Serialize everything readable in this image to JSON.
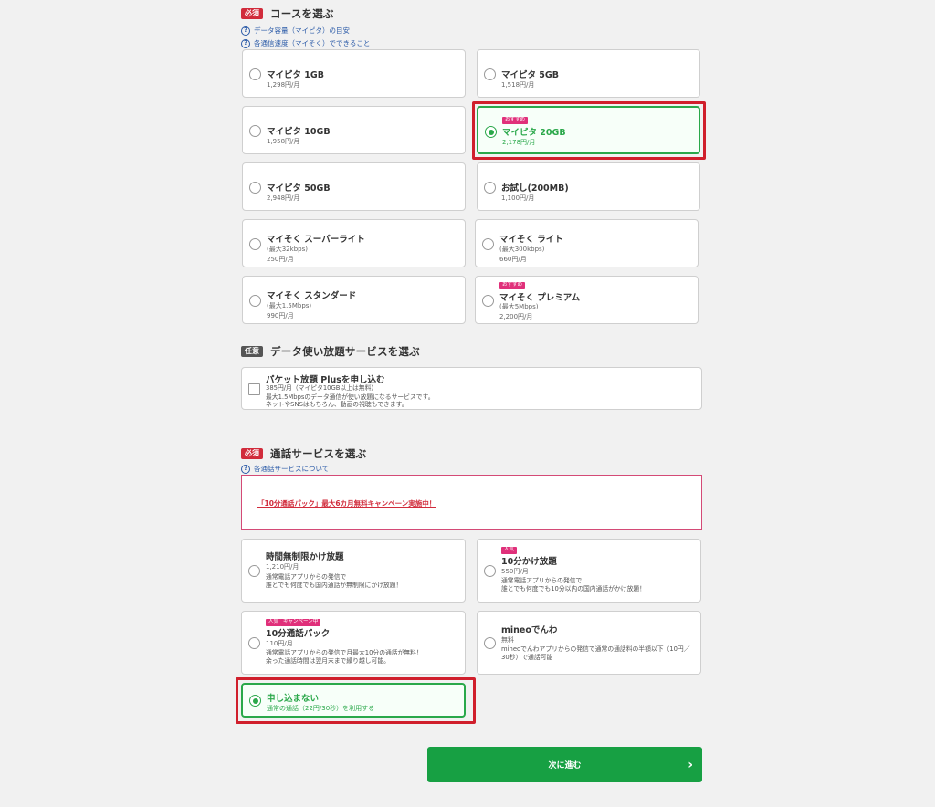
{
  "course": {
    "badge": "必須",
    "title": "コースを選ぶ",
    "help1": "データ容量（マイピタ）の目安",
    "help2": "各通信速度（マイそく）でできること",
    "plans": [
      {
        "name": "マイピタ 1GB",
        "price": "1,298円/月"
      },
      {
        "name": "マイピタ 5GB",
        "price": "1,518円/月"
      },
      {
        "name": "マイピタ 10GB",
        "price": "1,958円/月"
      },
      {
        "name": "マイピタ 20GB",
        "price": "2,178円/月",
        "tag": "おすすめ",
        "selected": true
      },
      {
        "name": "マイピタ 50GB",
        "price": "2,948円/月"
      },
      {
        "name": "お試し(200MB)",
        "price": "1,100円/月"
      },
      {
        "name": "マイそく スーパーライト",
        "speed": "(最大32kbps)",
        "price": "250円/月"
      },
      {
        "name": "マイそく ライト",
        "speed": "(最大300kbps)",
        "price": "660円/月"
      },
      {
        "name": "マイそく スタンダード",
        "speed": "(最大1.5Mbps)",
        "price": "990円/月"
      },
      {
        "name": "マイそく プレミアム",
        "speed": "(最大5Mbps)",
        "price": "2,200円/月",
        "tag": "おすすめ"
      }
    ]
  },
  "data_service": {
    "badge": "任意",
    "title": "データ使い放題サービスを選ぶ",
    "option": {
      "name": "パケット放題 Plusを申し込む",
      "price": "385円/月（マイピタ10GB以上は無料）",
      "desc1": "最大1.5Mbpsのデータ通信が使い放題になるサービスです。",
      "desc2": "ネットやSNSはもちろん、動画の視聴もできます。"
    }
  },
  "call": {
    "badge": "必須",
    "title": "通話サービスを選ぶ",
    "help": "各通話サービスについて",
    "promo": "「10分通話パック」最大6カ月無料キャンペーン実施中！",
    "options": [
      {
        "name": "時間無制限かけ放題",
        "price": "1,210円/月",
        "desc1": "通常電話アプリからの発信で",
        "desc2": "誰とでも何度でも国内通話が無制限にかけ放題！"
      },
      {
        "name": "10分かけ放題",
        "tag": "人気",
        "price": "550円/月",
        "desc1": "通常電話アプリからの発信で",
        "desc2": "誰とでも何度でも10分以内の国内通話がかけ放題！"
      },
      {
        "name": "10分通話パック",
        "tag": "人気",
        "tag2": "キャンペーン中",
        "price": "110円/月",
        "desc1": "通常電話アプリからの発信で月最大10分の通話が無料！",
        "desc2": "余った通話時間は翌月末まで繰り越し可能。"
      },
      {
        "name": "mineoでんわ",
        "price": "無料",
        "desc1": "mineoでんわアプリからの発信で通常の通話料の半額以下（10円／",
        "desc2": "30秒）で通話可能"
      },
      {
        "name": "申し込まない",
        "price": "通常の通話（22円/30秒）を利用する",
        "selected": true
      }
    ]
  },
  "next_button": "次に進む",
  "next_arrow": "›"
}
